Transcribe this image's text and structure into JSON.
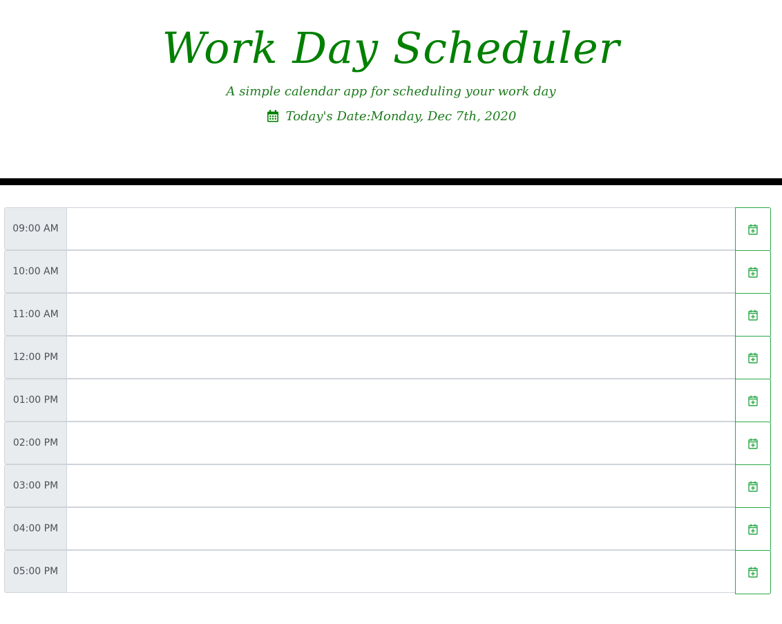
{
  "header": {
    "title": "Work Day Scheduler",
    "subtitle": "A simple calendar app for scheduling your work day",
    "date_label": "Today's Date:",
    "date_value": "Monday, Dec 7th, 2020",
    "date_icon": "calendar-icon"
  },
  "colors": {
    "accent": "#008000",
    "button_border": "#28a745",
    "hour_bg": "#e9ecef",
    "divider": "#000000"
  },
  "schedule": {
    "rows": [
      {
        "hour": "09:00 AM",
        "task": "",
        "save_icon": "calendar-plus-icon"
      },
      {
        "hour": "10:00 AM",
        "task": "",
        "save_icon": "calendar-plus-icon"
      },
      {
        "hour": "11:00 AM",
        "task": "",
        "save_icon": "calendar-plus-icon"
      },
      {
        "hour": "12:00 PM",
        "task": "",
        "save_icon": "calendar-plus-icon"
      },
      {
        "hour": "01:00 PM",
        "task": "",
        "save_icon": "calendar-plus-icon"
      },
      {
        "hour": "02:00 PM",
        "task": "",
        "save_icon": "calendar-plus-icon"
      },
      {
        "hour": "03:00 PM",
        "task": "",
        "save_icon": "calendar-plus-icon"
      },
      {
        "hour": "04:00 PM",
        "task": "",
        "save_icon": "calendar-plus-icon"
      },
      {
        "hour": "05:00 PM",
        "task": "",
        "save_icon": "calendar-plus-icon"
      }
    ]
  }
}
